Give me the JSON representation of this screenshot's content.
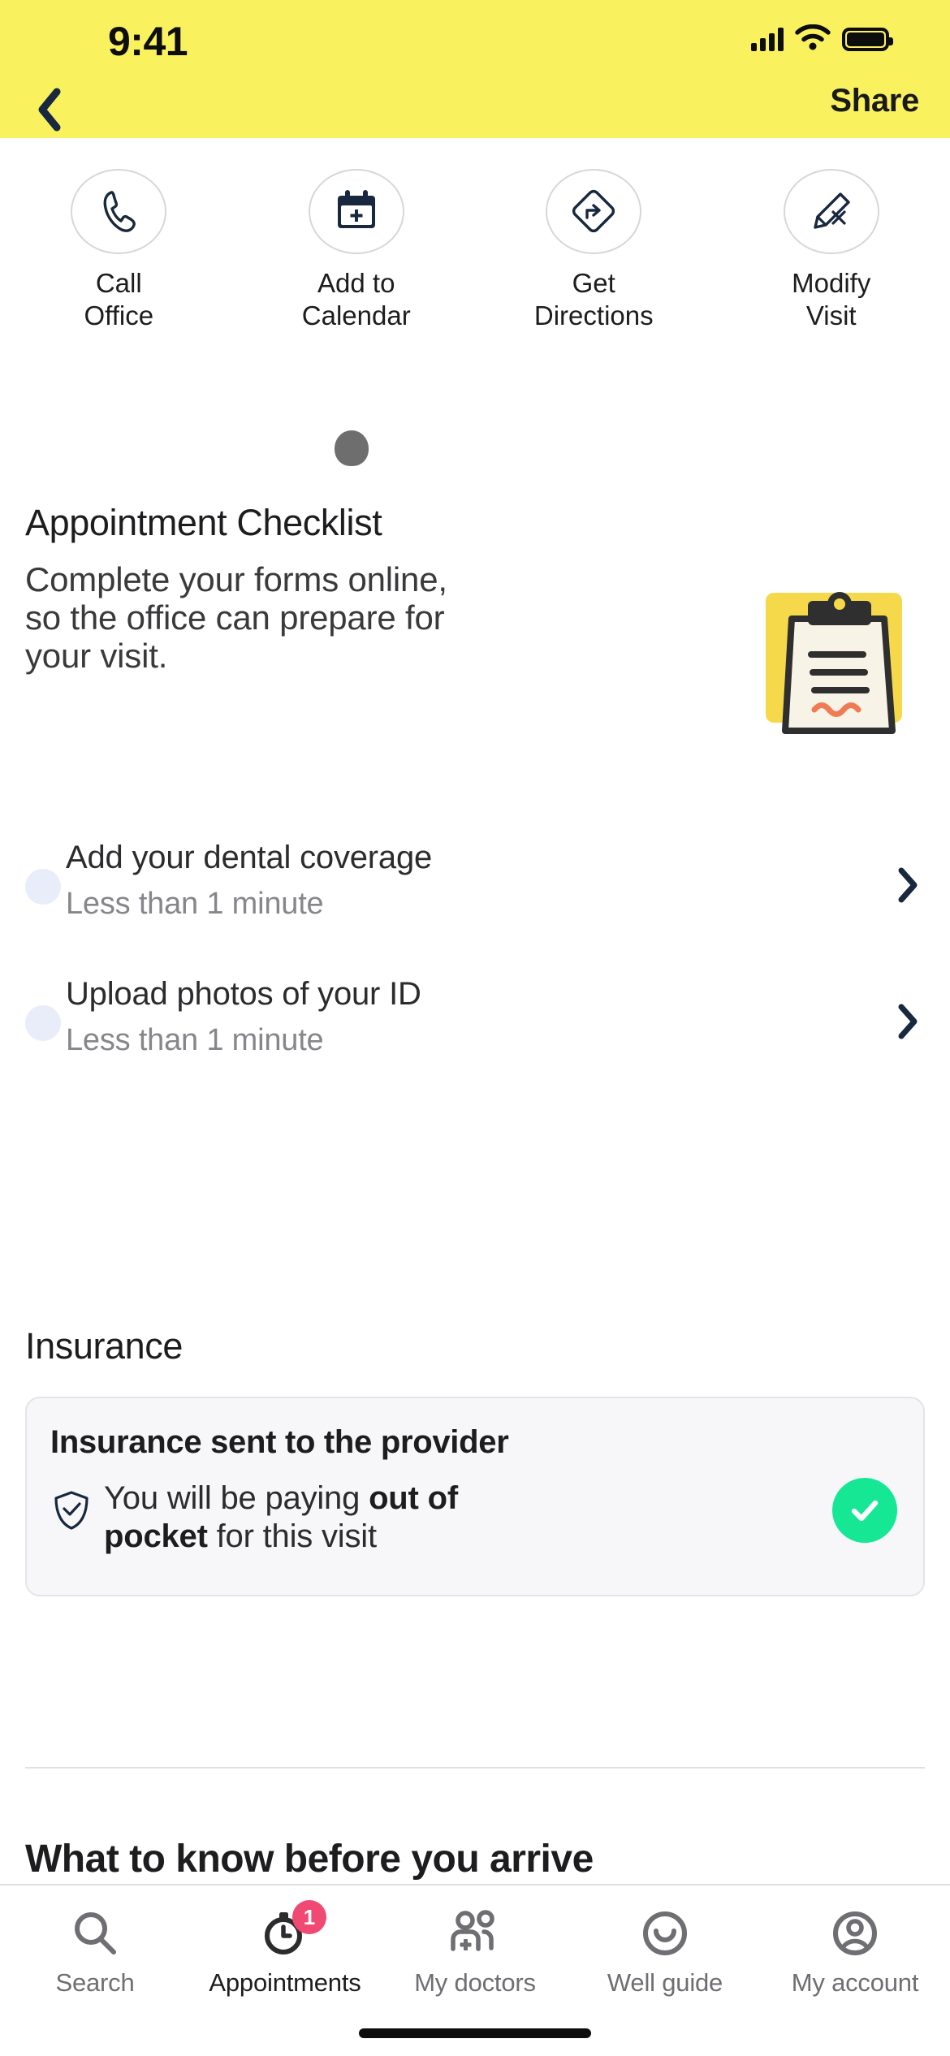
{
  "statusbar": {
    "time": "9:41",
    "icons": [
      "cellular-signal-icon",
      "wifi-icon",
      "battery-icon"
    ]
  },
  "navbar": {
    "back_label": "back-chevron-icon",
    "share_label": "Share",
    "background_color": "#faf15f"
  },
  "quick_actions": [
    {
      "label": "Call\nOffice",
      "icon": "phone-icon"
    },
    {
      "label": "Add to\nCalendar",
      "icon": "calendar-plus-icon"
    },
    {
      "label": "Get\nDirections",
      "icon": "directions-sign-icon"
    },
    {
      "label": "Modify\nVisit",
      "icon": "pencil-edit-icon"
    }
  ],
  "checklist": {
    "title": "Appointment Checklist",
    "description": "Complete your forms online, so the office can prepare for your visit.",
    "illustration": "clipboard-illustration",
    "items": [
      {
        "title": "Add your dental coverage",
        "duration": "Less than 1 minute",
        "chevron": "chevron-right-icon"
      },
      {
        "title": "Upload photos of your ID",
        "duration": "Less than 1 minute",
        "chevron": "chevron-right-icon"
      }
    ]
  },
  "insurance": {
    "title": "Insurance",
    "card": {
      "heading": "Insurance sent to the provider",
      "shield_icon": "shield-check-icon",
      "body_prefix": "You will be paying ",
      "body_bold": "out of pocket",
      "body_suffix": " for this visit",
      "status_icon": "check-circle-icon",
      "status_color": "#15e795"
    }
  },
  "arrive_section": {
    "title": "What to know before you arrive"
  },
  "tabbar": {
    "items": [
      {
        "label": "Search",
        "icon": "search-icon",
        "active": false,
        "badge": ""
      },
      {
        "label": "Appointments",
        "icon": "clock-icon",
        "active": true,
        "badge": "1"
      },
      {
        "label": "My doctors",
        "icon": "doctors-icon",
        "active": false,
        "badge": ""
      },
      {
        "label": "Well guide",
        "icon": "smiley-icon",
        "active": false,
        "badge": ""
      },
      {
        "label": "My account",
        "icon": "account-icon",
        "active": false,
        "badge": ""
      }
    ],
    "badge_color": "#f04a74"
  },
  "colors": {
    "brand_yellow": "#faf15f",
    "navy": "#17283f",
    "green": "#15e795",
    "pink": "#f04a74",
    "bullet_lavender": "#e9edfa"
  }
}
